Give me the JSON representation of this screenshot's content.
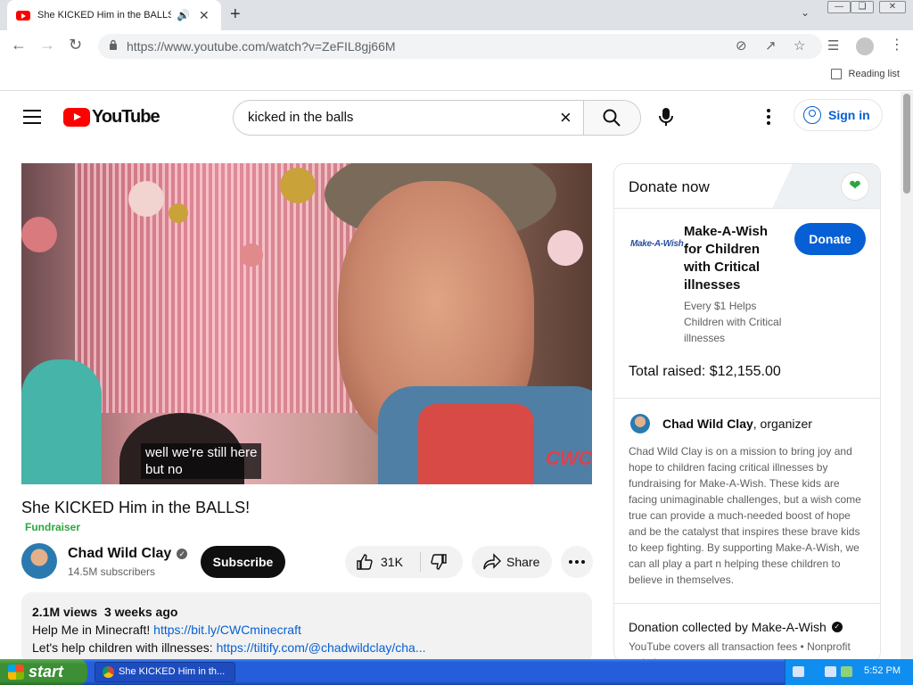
{
  "browser": {
    "tab_title": "She KICKED Him in the BALLS!",
    "url": "https://www.youtube.com/watch?v=ZeFIL8gj66M",
    "reading_list": "Reading list"
  },
  "youtube": {
    "logo_text": "YouTube",
    "search_query": "kicked in the balls",
    "sign_in": "Sign in"
  },
  "video": {
    "caption_line1": "well we're still here",
    "caption_line2": "but no",
    "title": "She KICKED Him in the BALLS!",
    "fundraiser_label": "Fundraiser",
    "channel_name": "Chad Wild Clay",
    "subscribers": "14.5M subscribers",
    "subscribe_label": "Subscribe",
    "likes": "31K",
    "share_label": "Share",
    "views": "2.1M views",
    "age": "3 weeks ago",
    "desc_line1_text": "Help Me in Minecraft! ",
    "desc_line1_link": "https://bit.ly/CWCminecraft",
    "desc_line2_text": "Let's help children with illnesses: ",
    "desc_line2_link": "https://tiltify.com/@chadwildclay/cha..."
  },
  "donate": {
    "header": "Donate now",
    "org_logo_text": "Make-A-Wish",
    "org_name": "Make-A-Wish for Children with Critical illnesses",
    "org_tagline": "Every $1 Helps Children with Critical illnesses",
    "donate_button": "Donate",
    "total_raised": "Total raised: $12,155.00",
    "organizer_name": "Chad Wild Clay",
    "organizer_suffix": ", organizer",
    "story": "Chad Wild Clay is on a mission to bring joy and hope to children facing critical illnesses by fundraising for Make-A-Wish. These kids are facing unimaginable challenges, but a wish come true can provide a much-needed boost of hope and be the catalyst that inspires these brave kids to keep fighting. By supporting Make-A-Wish, we can all play a part n helping these children to believe in themselves.",
    "collected_by": "Donation collected by Make-A-Wish",
    "fees_note": "YouTube covers all transaction fees • Nonprofit website"
  },
  "taskbar": {
    "start_label": "start",
    "task_title": "She KICKED Him in th...",
    "clock": "5:52 PM"
  }
}
